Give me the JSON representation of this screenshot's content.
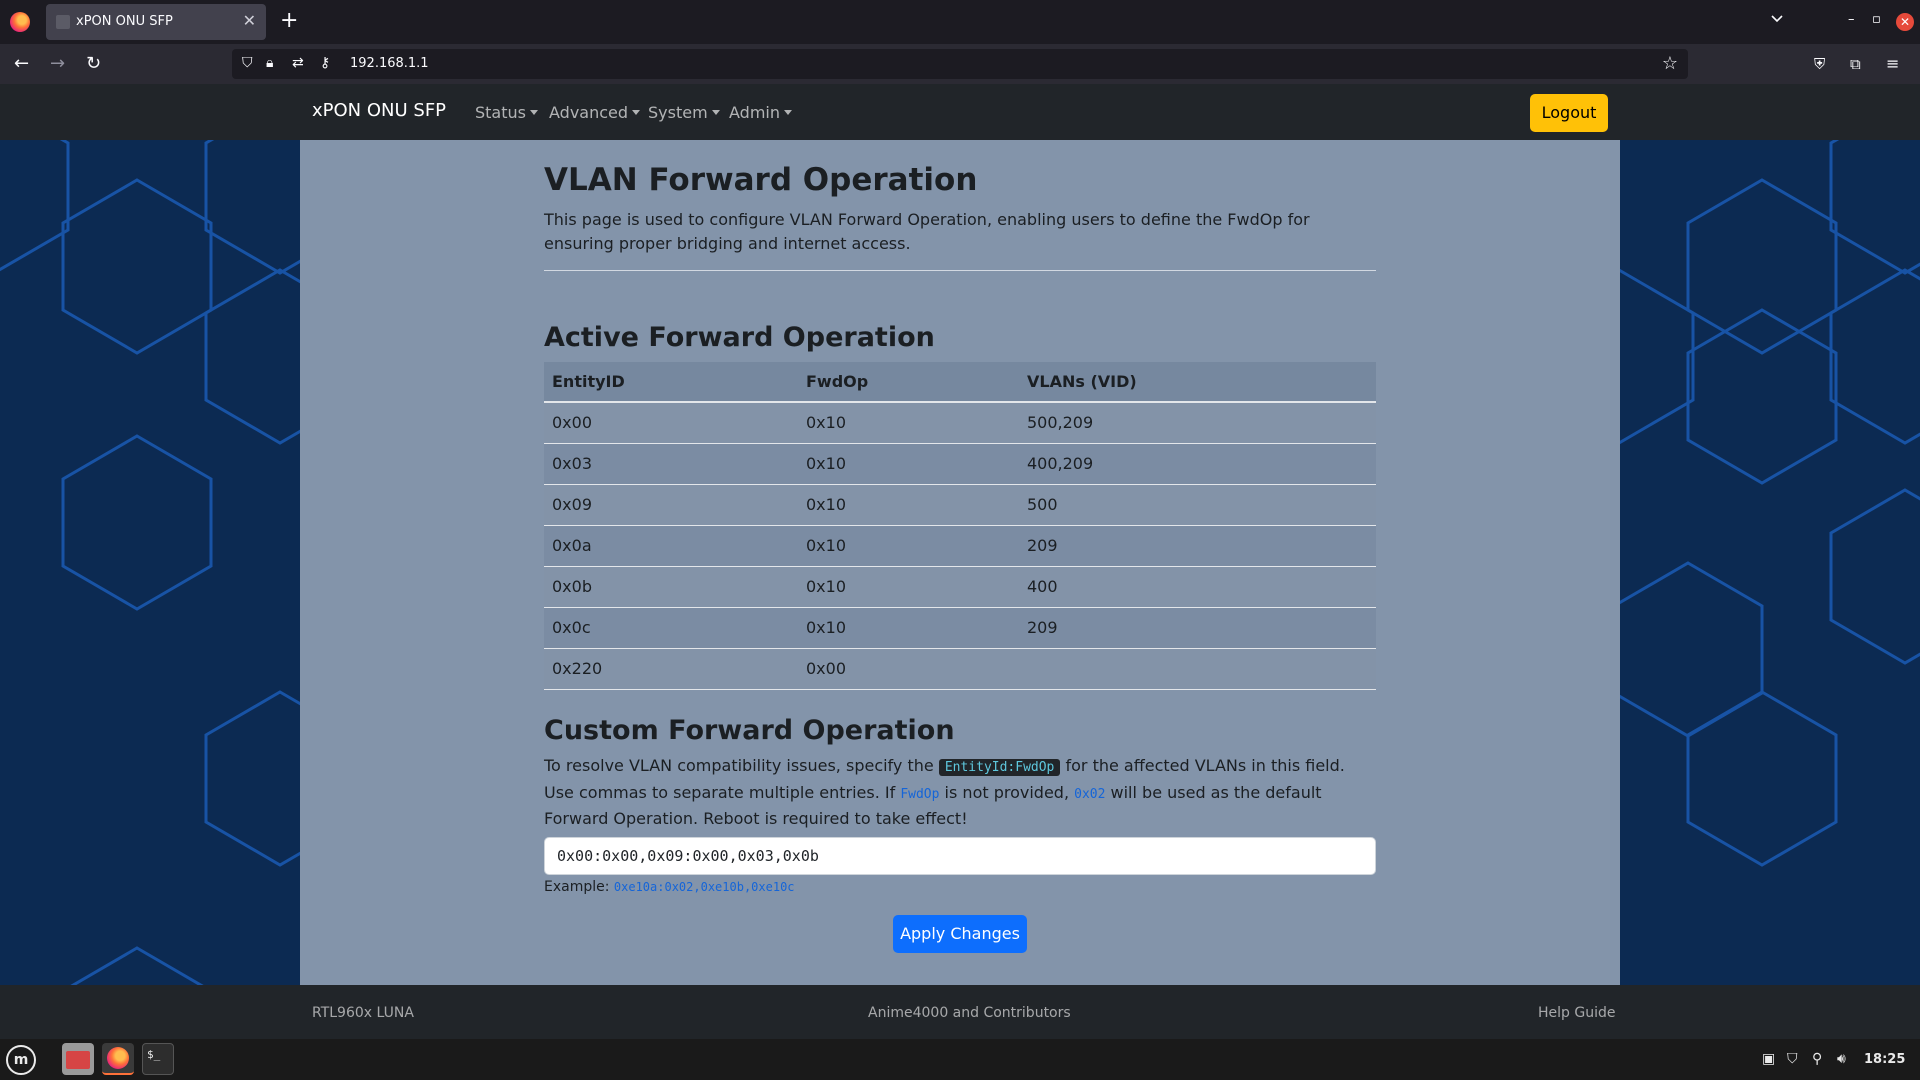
{
  "browser": {
    "tab_title": "xPON ONU SFP",
    "url": "192.168.1.1"
  },
  "site": {
    "brand": "xPON ONU SFP",
    "menus": [
      "Status",
      "Advanced",
      "System",
      "Admin"
    ],
    "logout_label": "Logout"
  },
  "page": {
    "title": "VLAN Forward Operation",
    "description": "This page is used to configure VLAN Forward Operation, enabling users to define the FwdOp for ensuring proper bridging and internet access.",
    "active_heading": "Active Forward Operation",
    "table": {
      "headers": [
        "EntityID",
        "FwdOp",
        "VLANs (VID)"
      ],
      "rows": [
        [
          "0x00",
          "0x10",
          "500,209"
        ],
        [
          "0x03",
          "0x10",
          "400,209"
        ],
        [
          "0x09",
          "0x10",
          "500"
        ],
        [
          "0x0a",
          "0x10",
          "209"
        ],
        [
          "0x0b",
          "0x10",
          "400"
        ],
        [
          "0x0c",
          "0x10",
          "209"
        ],
        [
          "0x220",
          "0x00",
          ""
        ]
      ]
    },
    "custom_heading": "Custom Forward Operation",
    "custom_desc": {
      "part1": "To resolve VLAN compatibility issues, specify the ",
      "kbd": "EntityId:FwdOp",
      "part2": " for the affected VLANs in this field. Use commas to separate multiple entries. If ",
      "code1": "FwdOp",
      "part3": " is not provided, ",
      "code2": "0x02",
      "part4": " will be used as the default Forward Operation. Reboot is required to take effect!"
    },
    "input_value": "0x00:0x00,0x09:0x00,0x03,0x0b",
    "example_label": "Example: ",
    "example_value": "0xe10a:0x02,0xe10b,0xe10c",
    "apply_label": "Apply Changes"
  },
  "footer": {
    "left": "RTL960x LUNA",
    "center": "Anime4000 and Contributors",
    "right": "Help Guide"
  },
  "taskbar": {
    "clock": "18:25"
  }
}
